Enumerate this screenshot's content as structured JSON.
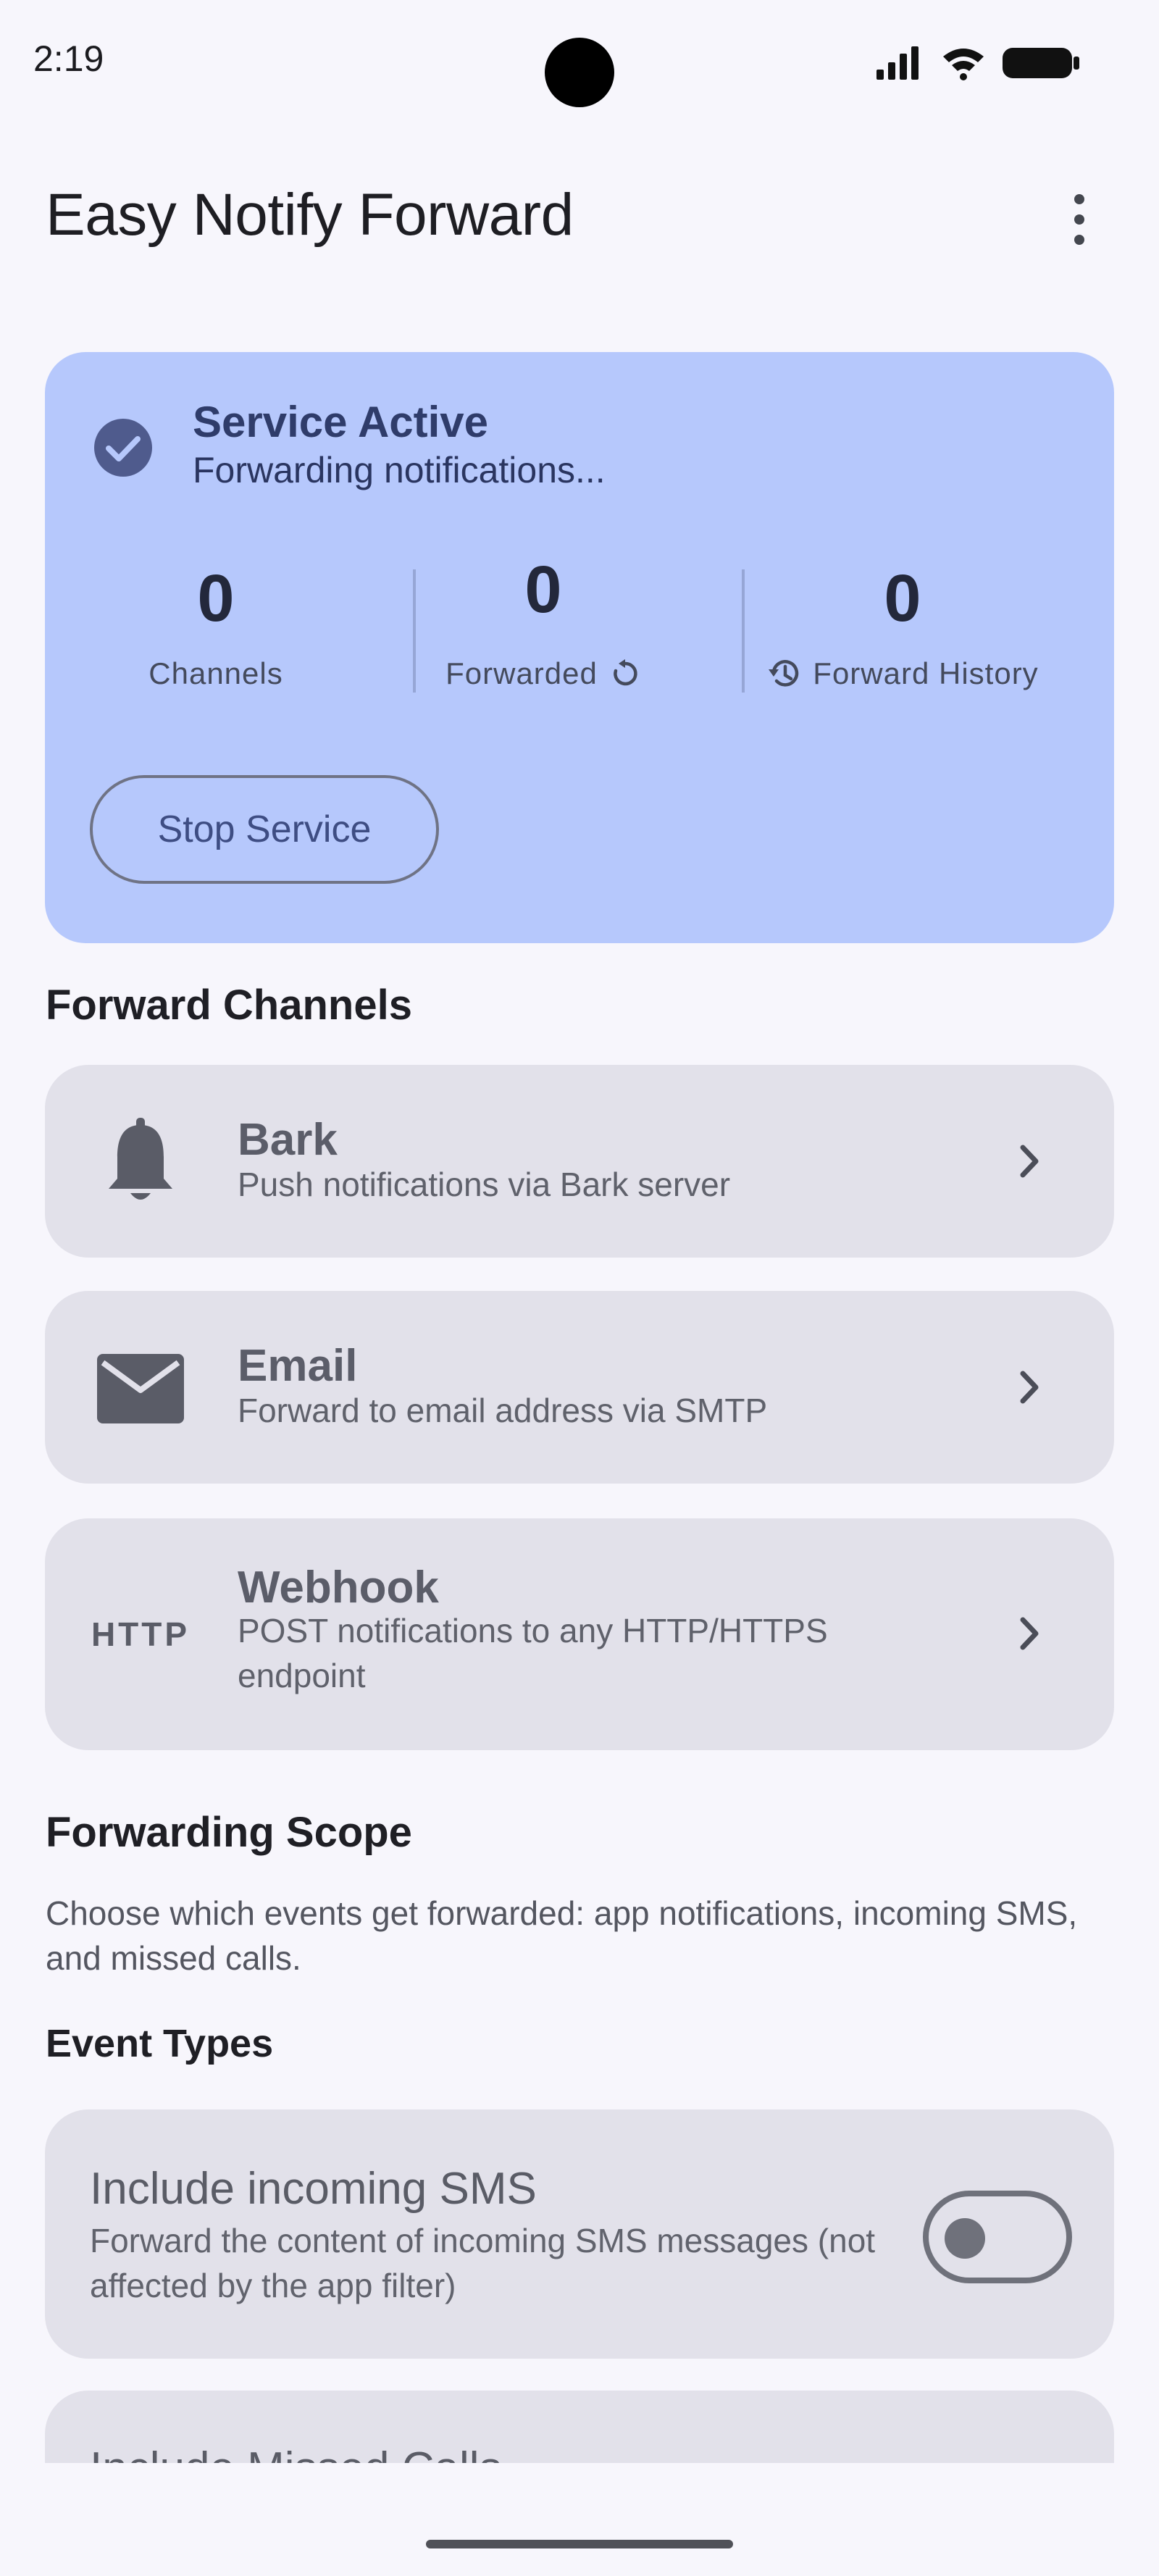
{
  "status_bar": {
    "time": "2:19"
  },
  "app": {
    "title": "Easy Notify Forward"
  },
  "service": {
    "title": "Service Active",
    "subtitle": "Forwarding notifications...",
    "stats": [
      {
        "value": "0",
        "label": "Channels"
      },
      {
        "value": "0",
        "label": "Forwarded"
      },
      {
        "value": "0",
        "label": "Forward History"
      }
    ],
    "stop_label": "Stop Service"
  },
  "channels_section": {
    "title": "Forward Channels",
    "items": [
      {
        "name": "Bark",
        "description": "Push notifications via Bark server",
        "icon": "bell-icon"
      },
      {
        "name": "Email",
        "description": "Forward to email address via SMTP",
        "icon": "mail-icon"
      },
      {
        "name": "Webhook",
        "description": "POST notifications to any HTTP/HTTPS endpoint",
        "icon": "http-icon",
        "icon_text": "HTTP"
      }
    ]
  },
  "scope": {
    "title": "Forwarding Scope",
    "description": "Choose which events get forwarded: app notifications, incoming SMS, and missed calls.",
    "event_types_title": "Event Types",
    "sms": {
      "title": "Include incoming SMS",
      "description": "Forward the content of incoming SMS messages (not affected by the app filter)",
      "enabled": false
    },
    "missed_calls": {
      "title": "Include Missed Calls"
    }
  },
  "colors": {
    "card_accent": "#b6c8fc",
    "card_neutral": "#e2e1ea",
    "background": "#f7f6fc"
  }
}
